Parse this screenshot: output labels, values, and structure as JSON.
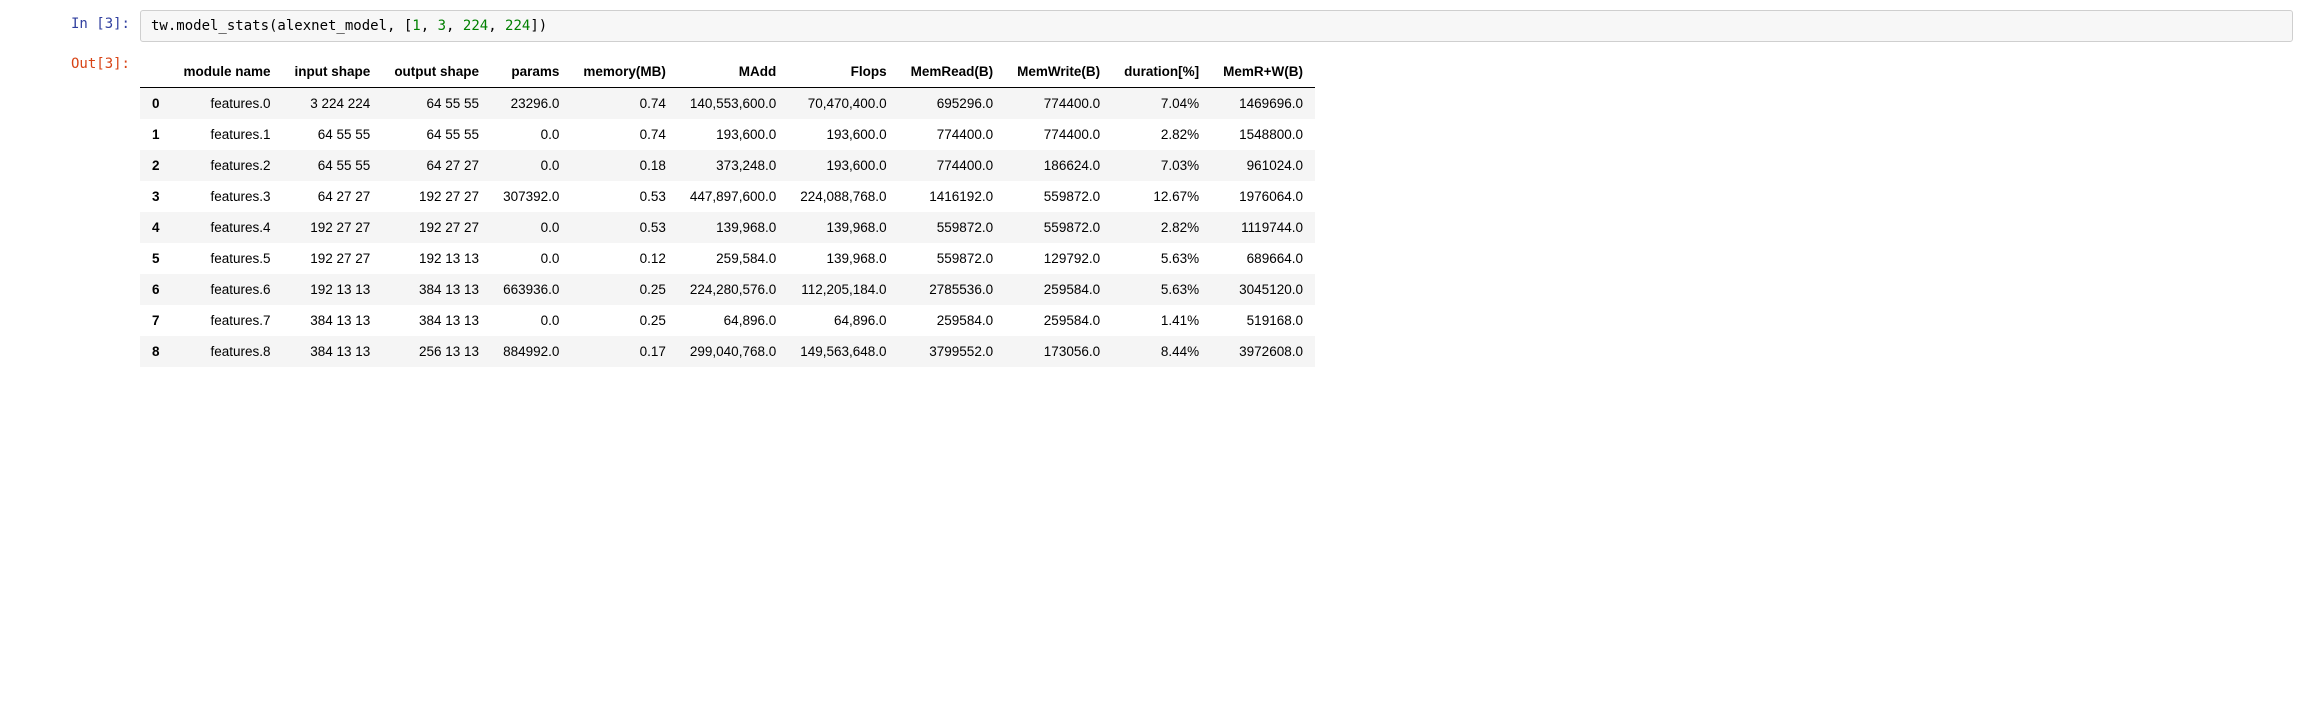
{
  "input": {
    "prompt_label": "In [3]:",
    "code_parts": [
      {
        "text": "tw.model_stats(alexnet_model, [",
        "cls": "c-black"
      },
      {
        "text": "1",
        "cls": "c-green"
      },
      {
        "text": ", ",
        "cls": "c-black"
      },
      {
        "text": "3",
        "cls": "c-green"
      },
      {
        "text": ", ",
        "cls": "c-black"
      },
      {
        "text": "224",
        "cls": "c-green"
      },
      {
        "text": ", ",
        "cls": "c-black"
      },
      {
        "text": "224",
        "cls": "c-green"
      },
      {
        "text": "])",
        "cls": "c-black"
      }
    ]
  },
  "output": {
    "prompt_label": "Out[3]:",
    "table": {
      "columns": [
        "module name",
        "input shape",
        "output shape",
        "params",
        "memory(MB)",
        "MAdd",
        "Flops",
        "MemRead(B)",
        "MemWrite(B)",
        "duration[%]",
        "MemR+W(B)"
      ],
      "rows": [
        {
          "idx": "0",
          "cells": [
            "features.0",
            "3 224 224",
            "64 55 55",
            "23296.0",
            "0.74",
            "140,553,600.0",
            "70,470,400.0",
            "695296.0",
            "774400.0",
            "7.04%",
            "1469696.0"
          ]
        },
        {
          "idx": "1",
          "cells": [
            "features.1",
            "64 55 55",
            "64 55 55",
            "0.0",
            "0.74",
            "193,600.0",
            "193,600.0",
            "774400.0",
            "774400.0",
            "2.82%",
            "1548800.0"
          ]
        },
        {
          "idx": "2",
          "cells": [
            "features.2",
            "64 55 55",
            "64 27 27",
            "0.0",
            "0.18",
            "373,248.0",
            "193,600.0",
            "774400.0",
            "186624.0",
            "7.03%",
            "961024.0"
          ]
        },
        {
          "idx": "3",
          "cells": [
            "features.3",
            "64 27 27",
            "192 27 27",
            "307392.0",
            "0.53",
            "447,897,600.0",
            "224,088,768.0",
            "1416192.0",
            "559872.0",
            "12.67%",
            "1976064.0"
          ]
        },
        {
          "idx": "4",
          "cells": [
            "features.4",
            "192 27 27",
            "192 27 27",
            "0.0",
            "0.53",
            "139,968.0",
            "139,968.0",
            "559872.0",
            "559872.0",
            "2.82%",
            "1119744.0"
          ]
        },
        {
          "idx": "5",
          "cells": [
            "features.5",
            "192 27 27",
            "192 13 13",
            "0.0",
            "0.12",
            "259,584.0",
            "139,968.0",
            "559872.0",
            "129792.0",
            "5.63%",
            "689664.0"
          ]
        },
        {
          "idx": "6",
          "cells": [
            "features.6",
            "192 13 13",
            "384 13 13",
            "663936.0",
            "0.25",
            "224,280,576.0",
            "112,205,184.0",
            "2785536.0",
            "259584.0",
            "5.63%",
            "3045120.0"
          ]
        },
        {
          "idx": "7",
          "cells": [
            "features.7",
            "384 13 13",
            "384 13 13",
            "0.0",
            "0.25",
            "64,896.0",
            "64,896.0",
            "259584.0",
            "259584.0",
            "1.41%",
            "519168.0"
          ]
        },
        {
          "idx": "8",
          "cells": [
            "features.8",
            "384 13 13",
            "256 13 13",
            "884992.0",
            "0.17",
            "299,040,768.0",
            "149,563,648.0",
            "3799552.0",
            "173056.0",
            "8.44%",
            "3972608.0"
          ]
        }
      ]
    }
  }
}
